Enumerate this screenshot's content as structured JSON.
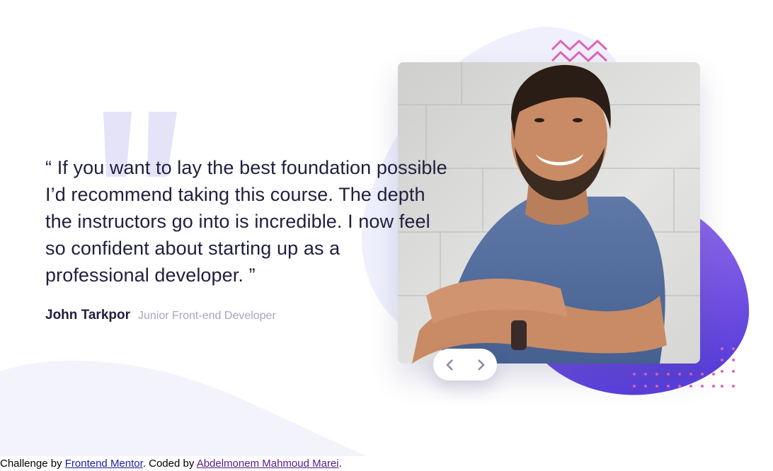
{
  "testimonial": {
    "quote": "“ If you want to lay the best foundation possible I’d recommend taking this course. The depth the instructors go into is incredible. I now feel so confident about starting up as a professional developer. ”",
    "author_name": "John Tarkpor",
    "author_role": "Junior Front-end Developer"
  },
  "navigation": {
    "prev_icon": "chevron-left-icon",
    "next_icon": "chevron-right-icon"
  },
  "footer": {
    "prefix": "Challenge by ",
    "frontend_mentor_link": "Frontend Mentor",
    "middle": ". Coded by ",
    "author_link": "Abdelmonem Mahmoud Marei",
    "suffix": "."
  },
  "colors": {
    "text_dark": "#202040",
    "text_muted": "#a5a5c3",
    "accent_purple": "#6b4ee0",
    "accent_pink": "#e064b4",
    "blob_light": "#eff0fc"
  }
}
